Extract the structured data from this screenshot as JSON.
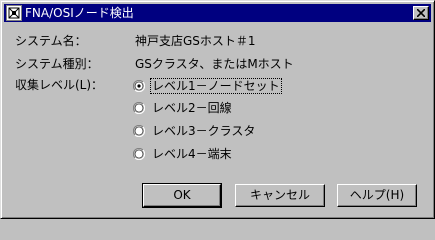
{
  "window": {
    "title": "FNA/OSIノード検出"
  },
  "fields": {
    "system_name_label": "システム名：",
    "system_name_value": "神戸支店GSホスト＃1",
    "system_type_label": "システム種別：",
    "system_type_value": "GSクラスタ、またはMホスト",
    "level_label": "収集レベル(L)："
  },
  "levels": [
    {
      "label": "レベル1－ノードセット",
      "selected": true
    },
    {
      "label": "レベル2－回線",
      "selected": false
    },
    {
      "label": "レベル3－クラスタ",
      "selected": false
    },
    {
      "label": "レベル4－端末",
      "selected": false
    }
  ],
  "buttons": {
    "ok": "OK",
    "cancel": "キャンセル",
    "help": "ヘルプ(H)"
  },
  "colors": {
    "titlebar": "#000080",
    "face": "#c0c0c0"
  }
}
